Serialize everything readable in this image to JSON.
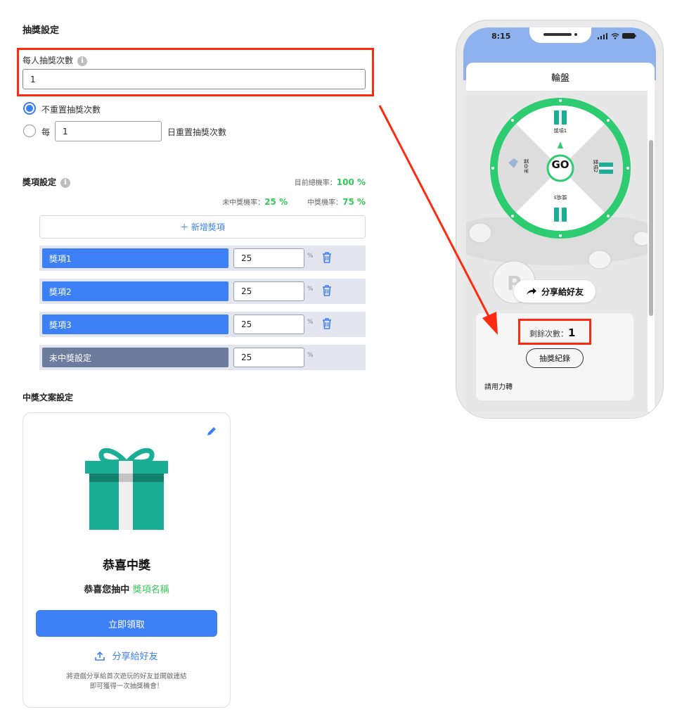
{
  "settings": {
    "section_title": "抽獎設定",
    "per_person_label": "每人抽獎次數",
    "per_person_value": "1",
    "radio_no_reset": "不重置抽獎次數",
    "radio_every": "每",
    "reset_days_value": "1",
    "radio_reset_suffix": "日重置抽獎次數"
  },
  "prizes": {
    "section_title": "獎項設定",
    "total_rate_label": "目前總機率：",
    "total_rate_value": "100 %",
    "no_win_rate_label": "未中獎機率：",
    "no_win_rate_value": "25 %",
    "win_rate_label": "中獎機率：",
    "win_rate_value": "75 %",
    "add_button": "＋ 新增獎項",
    "percent_sign": "%",
    "items": [
      {
        "name": "獎項1",
        "value": "25"
      },
      {
        "name": "獎項2",
        "value": "25"
      },
      {
        "name": "獎項3",
        "value": "25"
      },
      {
        "name": "未中獎設定",
        "value": "25"
      }
    ]
  },
  "win_message": {
    "section_title": "中獎文案設定",
    "heading": "恭喜中獎",
    "subtitle_prefix": "恭喜您抽中",
    "subtitle_highlight": "獎項名稱",
    "claim_button": "立即領取",
    "share_button": "分享給好友",
    "footnote_line1": "將遊戲分享給首次遊玩的好友並開啟連結",
    "footnote_line2": "即可獲得一次抽獎機會！"
  },
  "phone": {
    "time": "8:15",
    "header_title": "輪盤",
    "go_label": "GO",
    "segments": [
      "獎項1",
      "獎項2",
      "獎項3",
      "未中獎"
    ],
    "share_button": "分享給好友",
    "remaining_label": "剩餘次數：",
    "remaining_value": "1",
    "history_button": "抽獎紀錄",
    "bottom_text": "請用力轉"
  },
  "colors": {
    "accent_blue": "#3d7ff5",
    "highlight_red": "#ff2a12",
    "wheel_green": "#2ecc71",
    "gift_teal": "#1aae96"
  }
}
